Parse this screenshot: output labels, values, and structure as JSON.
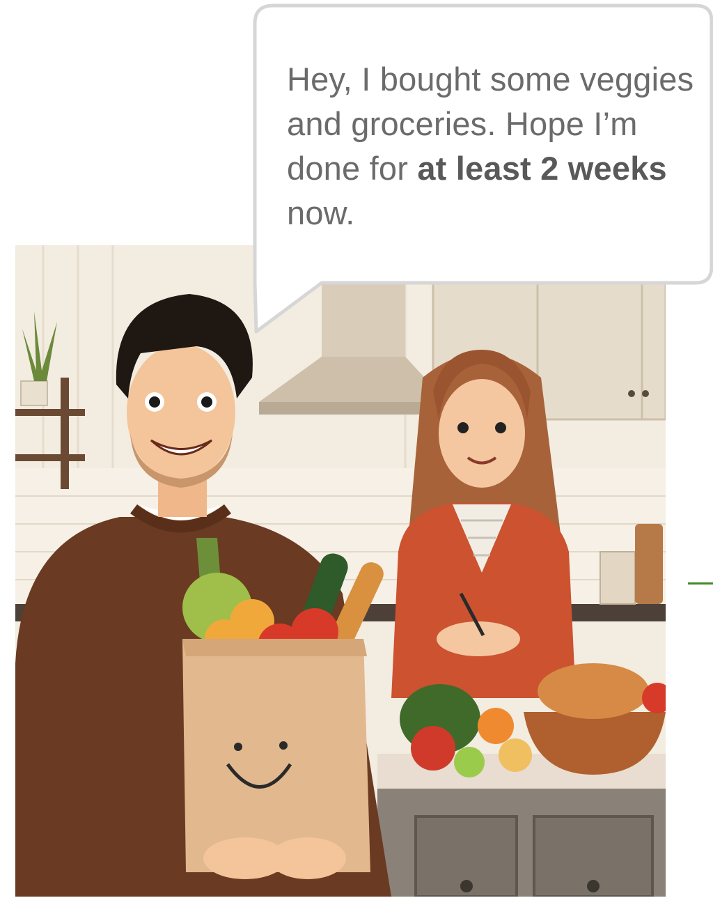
{
  "speech_bubble": {
    "text_part1": "Hey, I bought some veggies and groceries. Hope I’m done for ",
    "text_bold": "at least 2 weeks",
    "text_part2": " now."
  },
  "illustration": {
    "scene": "kitchen",
    "colors": {
      "wall": "#f3ece0",
      "tile": "#efe6d8",
      "cabinet": "#e4d9c8",
      "hood": "#d6c8b4",
      "counter": "#e6ddd0",
      "lower_cabinet": "#8a8278",
      "man_sweater": "#6a3a22",
      "woman_cardigan": "#cc5230",
      "bag": "#e2b88e",
      "accent_green": "#3f8a2a"
    }
  }
}
